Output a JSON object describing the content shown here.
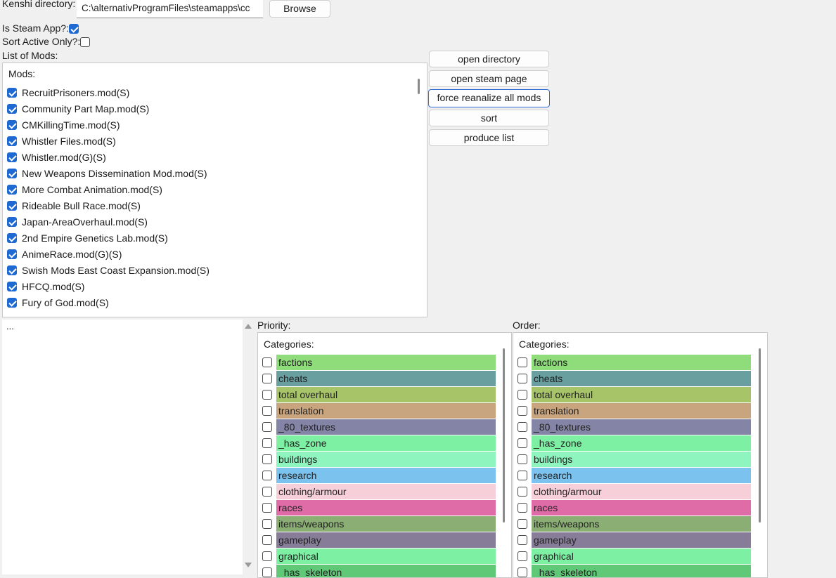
{
  "top": {
    "kenshi_dir_label": "Kenshi directory:",
    "kenshi_dir_value": "C:\\alternativProgramFiles\\steamapps\\cc",
    "browse_label": "Browse",
    "steam_app_label": "Is Steam App?:",
    "steam_app_checked": true,
    "sort_active_label": "Sort Active Only?:",
    "sort_active_checked": false,
    "list_of_mods_label": "List of Mods:"
  },
  "actions": {
    "open_directory": "open directory",
    "open_steam_page": "open steam page",
    "force_reanalize": "force reanalize all mods",
    "sort": "sort",
    "produce_list": "produce list"
  },
  "mods": {
    "header": "Mods:",
    "items": [
      {
        "label": "RecruitPrisoners.mod(S)",
        "checked": true
      },
      {
        "label": "Community Part Map.mod(S)",
        "checked": true
      },
      {
        "label": "CMKillingTime.mod(S)",
        "checked": true
      },
      {
        "label": "Whistler Files.mod(S)",
        "checked": true
      },
      {
        "label": "Whistler.mod(G)(S)",
        "checked": true
      },
      {
        "label": "New Weapons Dissemination Mod.mod(S)",
        "checked": true
      },
      {
        "label": "More Combat Animation.mod(S)",
        "checked": true
      },
      {
        "label": "Rideable Bull Race.mod(S)",
        "checked": true
      },
      {
        "label": "Japan-AreaOverhaul.mod(S)",
        "checked": true
      },
      {
        "label": "2nd Empire Genetics Lab.mod(S)",
        "checked": true
      },
      {
        "label": "AnimeRace.mod(G)(S)",
        "checked": true
      },
      {
        "label": "Swish Mods East Coast Expansion.mod(S)",
        "checked": true
      },
      {
        "label": "HFCQ.mod(S)",
        "checked": true
      },
      {
        "label": "Fury of God.mod(S)",
        "checked": true
      }
    ]
  },
  "log": {
    "text": "..."
  },
  "priority": {
    "label": "Priority:",
    "header": "Categories:"
  },
  "order": {
    "label": "Order:",
    "header": "Categories:"
  },
  "categories": [
    {
      "label": "factions",
      "color": "#8fdc7a"
    },
    {
      "label": "cheats",
      "color": "#6a9fa0"
    },
    {
      "label": "total overhaul",
      "color": "#a8c468"
    },
    {
      "label": "translation",
      "color": "#c8a57e"
    },
    {
      "label": "_80_textures",
      "color": "#8484a6"
    },
    {
      "label": "_has_zone",
      "color": "#7df0a4"
    },
    {
      "label": "buildings",
      "color": "#8ef5bf"
    },
    {
      "label": "research",
      "color": "#7cc2ee"
    },
    {
      "label": "clothing/armour",
      "color": "#f7cfd8"
    },
    {
      "label": "races",
      "color": "#df6ca6"
    },
    {
      "label": "items/weapons",
      "color": "#8aae74"
    },
    {
      "label": "gameplay",
      "color": "#877d98"
    },
    {
      "label": "graphical",
      "color": "#7df0a4"
    },
    {
      "label": "_has_skeleton",
      "color": "#60c978"
    }
  ]
}
